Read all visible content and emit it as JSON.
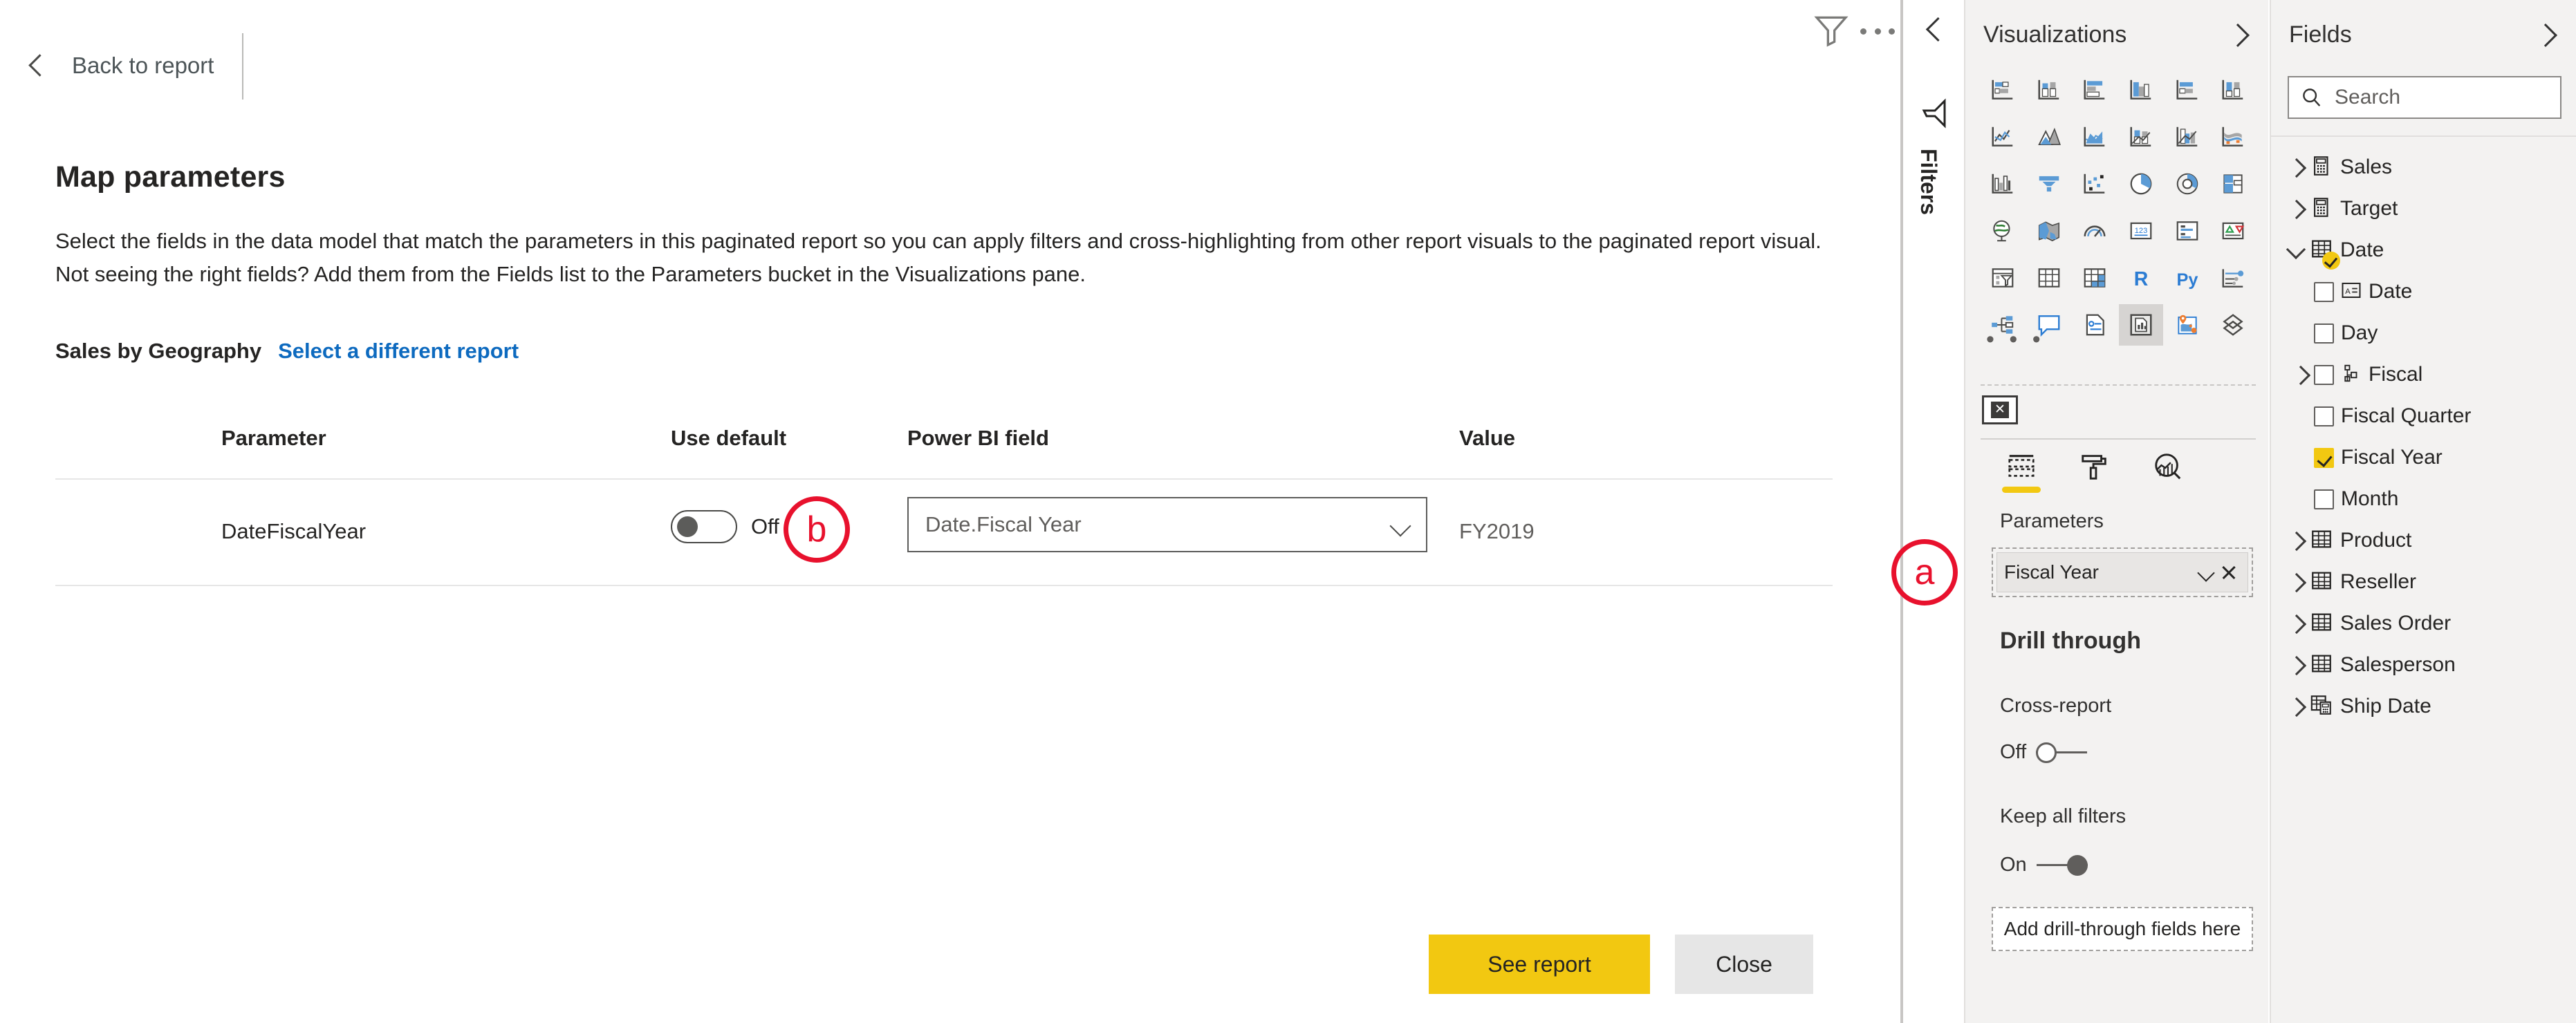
{
  "main": {
    "back_label": "Back to report",
    "back_icon": "chevron-left-icon",
    "funnel_icon": "filter-funnel-icon",
    "ellipsis_icon": "more-options-icon",
    "page_title": "Map parameters",
    "description": "Select the fields in the data model that match the parameters in this paginated report so you can apply filters and cross-highlighting from other report visuals to the paginated report visual. Not seeing the right fields? Add them from the Fields list to the Parameters bucket in the Visualizations pane.",
    "report_name": "Sales by Geography",
    "report_change_link": "Select a different report",
    "table": {
      "columns": [
        "Parameter",
        "Use default",
        "Power BI field",
        "Value"
      ],
      "rows": [
        {
          "parameter": "DateFiscalYear",
          "use_default_state": "Off",
          "use_default_label": "Off",
          "power_bi_field": "Date.Fiscal Year",
          "value": "FY2019"
        }
      ]
    },
    "buttons": {
      "primary_label": "See report",
      "primary_color": "#f2c811",
      "secondary_label": "Close",
      "secondary_color": "#e6e6e6"
    }
  },
  "filters_rail": {
    "collapse_icon": "chevron-left-icon",
    "funnel_icon": "filter-funnel-icon",
    "label": "Filters"
  },
  "visualizations": {
    "title": "Visualizations",
    "expand_icon": "chevron-right-icon",
    "more_label": "• • •",
    "icons": [
      "stacked-bar-chart-icon",
      "stacked-column-chart-icon",
      "clustered-bar-chart-icon",
      "clustered-column-chart-icon",
      "hundred-percent-stacked-bar-chart-icon",
      "hundred-percent-stacked-column-chart-icon",
      "line-chart-icon",
      "area-chart-icon",
      "stacked-area-chart-icon",
      "line-stacked-column-chart-icon",
      "line-clustered-column-chart-icon",
      "ribbon-chart-icon",
      "waterfall-chart-icon",
      "funnel-chart-icon",
      "scatter-chart-icon",
      "pie-chart-icon",
      "donut-chart-icon",
      "treemap-icon",
      "map-icon",
      "filled-map-icon",
      "gauge-icon",
      "card-icon",
      "multi-row-card-icon",
      "kpi-icon",
      "slicer-icon",
      "table-icon",
      "matrix-icon",
      "r-script-visual-icon",
      "python-visual-icon",
      "key-influencers-icon",
      "decomposition-tree-icon",
      "qna-icon",
      "smart-narrative-icon",
      "paginated-report-icon",
      "azure-map-icon",
      "power-apps-icon"
    ],
    "selected_icon": "paginated-report-icon",
    "field_well_icon": "format-visual-icon",
    "tabs": [
      {
        "name": "fields-tab",
        "icon": "fields-build-icon",
        "active": true
      },
      {
        "name": "format-tab",
        "icon": "paint-roller-icon",
        "active": false
      },
      {
        "name": "analytics-tab",
        "icon": "analytics-magnifier-icon",
        "active": false
      }
    ],
    "parameters_label": "Parameters",
    "parameters_chip": "Fiscal Year",
    "chip_chevron_icon": "chevron-down-icon",
    "chip_remove_icon": "close-icon",
    "drill_through": {
      "title": "Drill through",
      "cross_report_label": "Cross-report",
      "cross_report_state": "Off",
      "keep_all_filters_label": "Keep all filters",
      "keep_all_filters_state": "On",
      "drop_zone_label": "Add drill-through fields here"
    }
  },
  "fields": {
    "title": "Fields",
    "expand_icon": "chevron-right-icon",
    "search_placeholder": "Search",
    "search_value": "",
    "search_icon": "search-icon",
    "tree": [
      {
        "label": "Sales",
        "level": 0,
        "expander": "right",
        "icon": "calculated-table-icon",
        "checkbox": null,
        "badge": false
      },
      {
        "label": "Target",
        "level": 0,
        "expander": "right",
        "icon": "calculated-table-icon",
        "checkbox": null,
        "badge": false
      },
      {
        "label": "Date",
        "level": 0,
        "expander": "down",
        "icon": "table-icon",
        "checkbox": null,
        "badge": true
      },
      {
        "label": "Date",
        "level": 1,
        "expander": null,
        "icon": "text-field-icon",
        "checkbox": false,
        "badge": false
      },
      {
        "label": "Day",
        "level": 1,
        "expander": null,
        "icon": null,
        "checkbox": false,
        "badge": false
      },
      {
        "label": "Fiscal",
        "level": 1,
        "expander": "right",
        "icon": "hierarchy-icon",
        "checkbox": false,
        "badge": false
      },
      {
        "label": "Fiscal Quarter",
        "level": 1,
        "expander": null,
        "icon": null,
        "checkbox": false,
        "badge": false
      },
      {
        "label": "Fiscal Year",
        "level": 1,
        "expander": null,
        "icon": null,
        "checkbox": true,
        "badge": false
      },
      {
        "label": "Month",
        "level": 1,
        "expander": null,
        "icon": null,
        "checkbox": false,
        "badge": false
      },
      {
        "label": "Product",
        "level": 0,
        "expander": "right",
        "icon": "table-icon",
        "checkbox": null,
        "badge": false
      },
      {
        "label": "Reseller",
        "level": 0,
        "expander": "right",
        "icon": "table-icon",
        "checkbox": null,
        "badge": false
      },
      {
        "label": "Sales Order",
        "level": 0,
        "expander": "right",
        "icon": "table-icon",
        "checkbox": null,
        "badge": false
      },
      {
        "label": "Salesperson",
        "level": 0,
        "expander": "right",
        "icon": "table-icon",
        "checkbox": null,
        "badge": false
      },
      {
        "label": "Ship Date",
        "level": 0,
        "expander": "right",
        "icon": "date-table-icon",
        "checkbox": null,
        "badge": false
      }
    ]
  },
  "annotations": [
    {
      "label": "a",
      "target": "parameters-chip",
      "color": "#e8112d"
    },
    {
      "label": "b",
      "target": "power-bi-field-combobox",
      "color": "#e8112d"
    }
  ]
}
